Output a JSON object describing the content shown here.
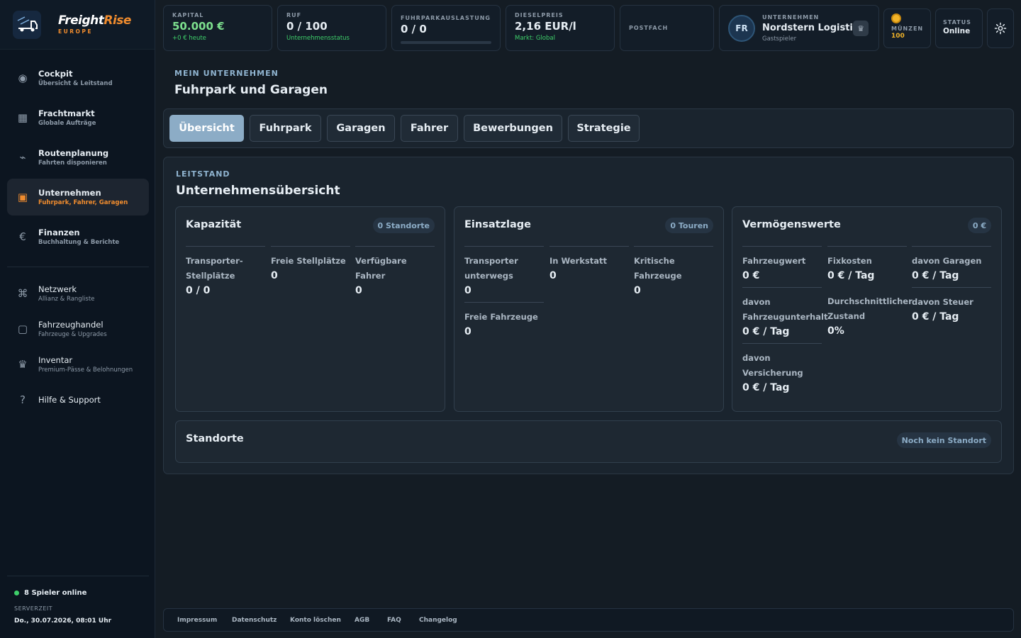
{
  "brand": {
    "name_a": "Freight",
    "name_b": "Rise",
    "region": "EUROPE"
  },
  "sidebar": {
    "primary": [
      {
        "title": "Cockpit",
        "sub": "Übersicht & Leitstand",
        "icon": "dashboard-icon"
      },
      {
        "title": "Frachtmarkt",
        "sub": "Globale Aufträge",
        "icon": "grid-icon"
      },
      {
        "title": "Routenplanung",
        "sub": "Fahrten disponieren",
        "icon": "route-icon"
      },
      {
        "title": "Unternehmen",
        "sub": "Fuhrpark, Fahrer, Garagen",
        "icon": "company-icon",
        "active": true
      },
      {
        "title": "Finanzen",
        "sub": "Buchhaltung & Berichte",
        "icon": "euro-icon"
      }
    ],
    "secondary": [
      {
        "title": "Netzwerk",
        "sub": "Allianz & Rangliste",
        "icon": "command-icon"
      },
      {
        "title": "Fahrzeughandel",
        "sub": "Fahrzeuge & Upgrades",
        "icon": "square-icon"
      },
      {
        "title": "Inventar",
        "sub": "Premium-Pässe & Belohnungen",
        "icon": "crown-icon"
      },
      {
        "title": "Hilfe & Support",
        "sub": "",
        "icon": "help-icon"
      }
    ],
    "footer": {
      "online": "8 Spieler online",
      "server_label": "SERVERZEIT",
      "server_time": "Do., 30.07.2026, 08:01 Uhr"
    }
  },
  "topbar": {
    "kapital": {
      "label": "KAPITAL",
      "value": "50.000 €",
      "sub": "+0 € heute"
    },
    "ruf": {
      "label": "RUF",
      "value": "0 / 100",
      "sub": "Unternehmensstatus"
    },
    "fuhrpark": {
      "label": "FUHRPARKAUSLASTUNG",
      "value": "0 / 0",
      "fill": 0
    },
    "diesel": {
      "label": "DIESELPREIS",
      "value": "2,16 EUR/l",
      "sub": "Markt: Global"
    },
    "postfach": {
      "label": "POSTFACH"
    },
    "company": {
      "label": "UNTERNEHMEN",
      "initials": "FR",
      "name": "Nordstern Logistik",
      "role": "Gastspieler"
    },
    "coins": {
      "label": "MÜNZEN",
      "value": "100"
    },
    "status": {
      "label": "STATUS",
      "value": "Online"
    }
  },
  "page": {
    "label": "MEIN UNTERNEHMEN",
    "title": "Fuhrpark und Garagen"
  },
  "tabs": [
    "Übersicht",
    "Fuhrpark",
    "Garagen",
    "Fahrer",
    "Bewerbungen",
    "Strategie"
  ],
  "panel": {
    "label": "LEITSTAND",
    "title": "Unternehmensübersicht",
    "kapazitaet": {
      "title": "Kapazität",
      "badge": "0 Standorte",
      "cells": [
        {
          "label": "Transporter-Stellplätze",
          "value": "0 / 0"
        },
        {
          "label": "Freie Stellplätze",
          "value": "0"
        },
        {
          "label": "Verfügbare Fahrer",
          "value": "0"
        }
      ]
    },
    "einsatz": {
      "title": "Einsatzlage",
      "badge": "0 Touren",
      "cells": [
        {
          "label": "Transporter unterwegs",
          "value": "0"
        },
        {
          "label": "In Werkstatt",
          "value": "0"
        },
        {
          "label": "Kritische Fahrzeuge",
          "value": "0"
        },
        {
          "label": "Freie Fahrzeuge",
          "value": "0"
        }
      ]
    },
    "verm": {
      "title": "Vermögenswerte",
      "badge": "0 €",
      "cells": [
        {
          "label": "Fahrzeugwert",
          "value": "0 €"
        },
        {
          "label": "Fixkosten",
          "value": "0 € / Tag"
        },
        {
          "label": "davon Garagen",
          "value": "0 € / Tag"
        },
        {
          "label": "davon Fahrzeugunterhalt",
          "value": "0 € / Tag"
        },
        {
          "label": "Durchschnittlicher Zustand",
          "value": "0%"
        },
        {
          "label": "davon Steuer",
          "value": "0 € / Tag"
        },
        {
          "label": "davon Versicherung",
          "value": "0 € / Tag"
        }
      ]
    },
    "standorte": {
      "title": "Standorte",
      "badge": "Noch kein Standort"
    }
  },
  "footer_links": [
    "Impressum",
    "Datenschutz",
    "Konto löschen",
    "AGB",
    "FAQ",
    "Changelog"
  ]
}
